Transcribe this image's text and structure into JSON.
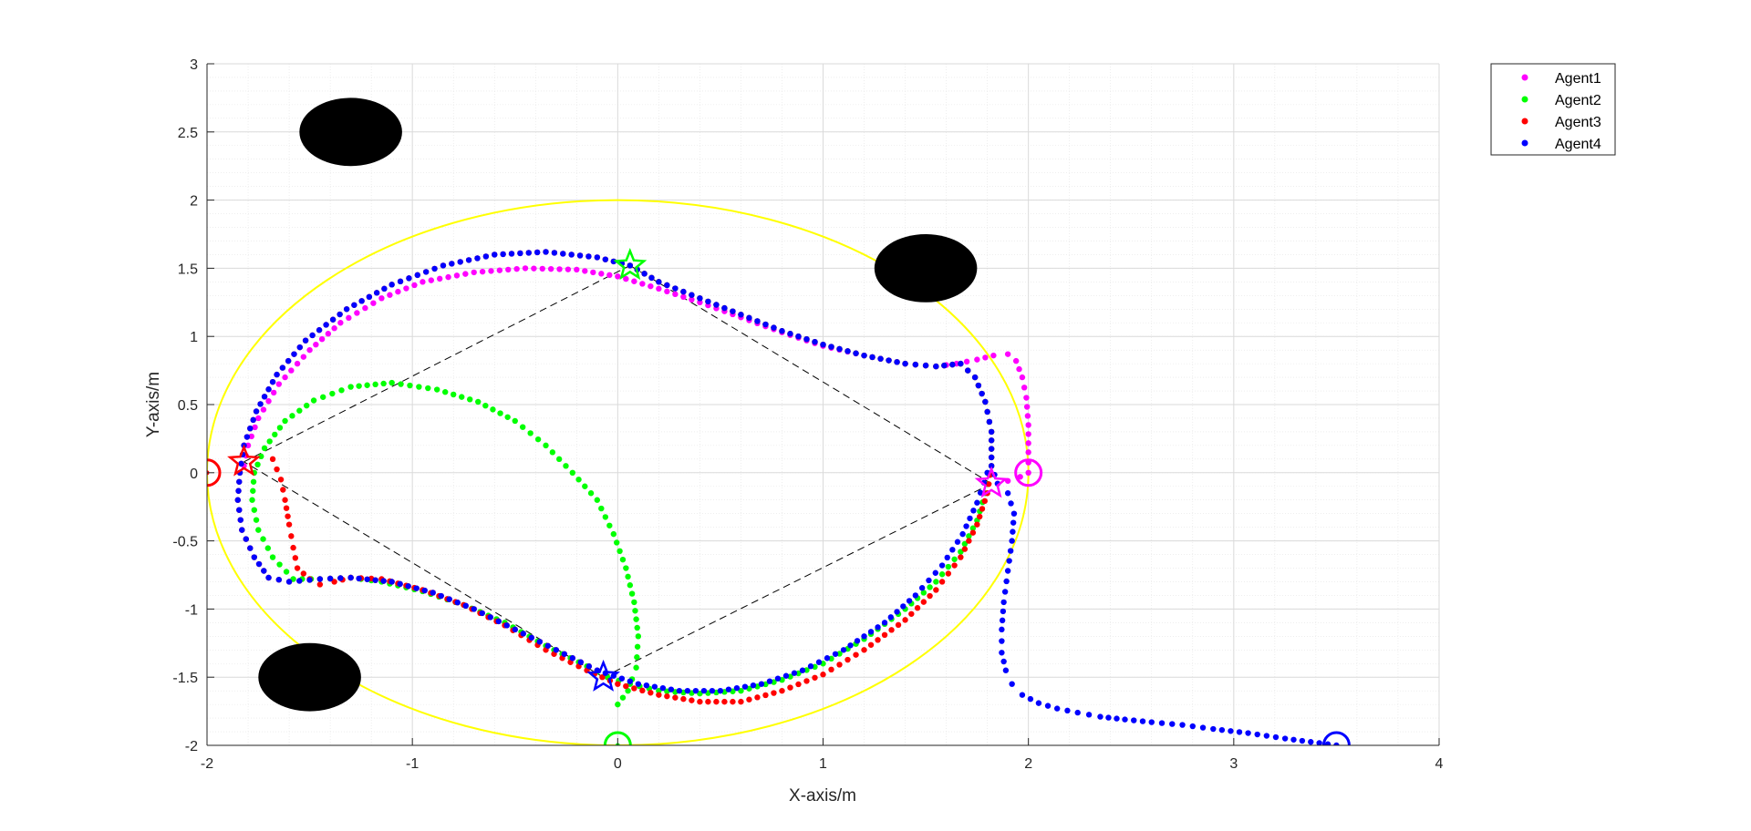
{
  "chart_data": {
    "type": "scatter",
    "xlabel": "X-axis/m",
    "ylabel": "Y-axis/m",
    "xlim": [
      -2,
      4
    ],
    "ylim": [
      -2,
      3
    ],
    "x_ticks": [
      "-2",
      "-1",
      "0",
      "1",
      "2",
      "3",
      "4"
    ],
    "y_ticks": [
      "-2",
      "-1.5",
      "-1",
      "-0.5",
      "0",
      "0.5",
      "1",
      "1.5",
      "2",
      "2.5",
      "3"
    ],
    "x_tick_values": [
      -2,
      -1,
      0,
      1,
      2,
      3,
      4
    ],
    "y_tick_values": [
      -2,
      -1.5,
      -1,
      -0.5,
      0,
      0.5,
      1,
      1.5,
      2,
      2.5,
      3
    ],
    "grid": true,
    "minor_grid": true,
    "legend_position": "outside top-right",
    "legend": [
      "Agent1",
      "Agent2",
      "Agent3",
      "Agent4"
    ],
    "series": [
      {
        "name": "Agent1",
        "color": "#ff00ff",
        "start": [
          2,
          0
        ],
        "goal": [
          1.82,
          -0.08
        ],
        "points": [
          [
            -1.82,
            0.05
          ],
          [
            -1.8,
            0.2
          ],
          [
            -1.75,
            0.4
          ],
          [
            -1.65,
            0.65
          ],
          [
            -1.5,
            0.9
          ],
          [
            -1.35,
            1.1
          ],
          [
            -1.15,
            1.28
          ],
          [
            -0.95,
            1.4
          ],
          [
            -0.7,
            1.47
          ],
          [
            -0.45,
            1.5
          ],
          [
            -0.2,
            1.49
          ],
          [
            0.0,
            1.44
          ],
          [
            0.2,
            1.35
          ],
          [
            0.4,
            1.25
          ],
          [
            0.6,
            1.14
          ],
          [
            0.8,
            1.03
          ],
          [
            1.0,
            0.93
          ],
          [
            1.2,
            0.86
          ],
          [
            1.4,
            0.8
          ],
          [
            1.55,
            0.78
          ],
          [
            1.65,
            0.8
          ],
          [
            1.75,
            0.83
          ],
          [
            1.83,
            0.86
          ],
          [
            1.9,
            0.87
          ],
          [
            1.94,
            0.82
          ],
          [
            1.97,
            0.7
          ],
          [
            1.99,
            0.55
          ],
          [
            2.0,
            0.35
          ],
          [
            2.0,
            0.15
          ],
          [
            2.0,
            0.0
          ],
          [
            1.96,
            -0.03
          ],
          [
            1.9,
            -0.06
          ],
          [
            1.85,
            -0.08
          ]
        ]
      },
      {
        "name": "Agent2",
        "color": "#00ff00",
        "start": [
          0,
          -2
        ],
        "goal": [
          0.06,
          1.52
        ],
        "points": [
          [
            0.0,
            -1.7
          ],
          [
            0.05,
            -1.6
          ],
          [
            0.09,
            -1.43
          ],
          [
            0.1,
            -1.2
          ],
          [
            0.08,
            -0.95
          ],
          [
            0.04,
            -0.7
          ],
          [
            -0.02,
            -0.45
          ],
          [
            -0.1,
            -0.2
          ],
          [
            -0.22,
            0.0
          ],
          [
            -0.35,
            0.2
          ],
          [
            -0.5,
            0.38
          ],
          [
            -0.68,
            0.52
          ],
          [
            -0.88,
            0.61
          ],
          [
            -1.1,
            0.66
          ],
          [
            -1.3,
            0.63
          ],
          [
            -1.48,
            0.53
          ],
          [
            -1.62,
            0.38
          ],
          [
            -1.72,
            0.18
          ],
          [
            -1.77,
            0.0
          ],
          [
            -1.78,
            -0.2
          ],
          [
            -1.75,
            -0.42
          ],
          [
            -1.68,
            -0.62
          ],
          [
            -1.58,
            -0.78
          ],
          [
            -1.45,
            -0.78
          ],
          [
            -1.3,
            -0.77
          ],
          [
            -1.15,
            -0.8
          ],
          [
            -0.95,
            -0.87
          ],
          [
            -0.75,
            -0.97
          ],
          [
            -0.55,
            -1.1
          ],
          [
            -0.35,
            -1.27
          ],
          [
            -0.15,
            -1.42
          ],
          [
            -0.05,
            -1.5
          ],
          [
            0.06,
            -1.55
          ],
          [
            0.2,
            -1.6
          ],
          [
            0.4,
            -1.62
          ],
          [
            0.6,
            -1.6
          ],
          [
            0.8,
            -1.52
          ],
          [
            1.0,
            -1.4
          ],
          [
            1.2,
            -1.22
          ],
          [
            1.4,
            -1.0
          ],
          [
            1.55,
            -0.8
          ],
          [
            1.67,
            -0.58
          ],
          [
            1.75,
            -0.35
          ],
          [
            1.79,
            -0.15
          ],
          [
            1.82,
            0.05
          ],
          [
            1.82,
            0.3
          ],
          [
            1.79,
            0.52
          ],
          [
            1.74,
            0.7
          ],
          [
            1.67,
            0.8
          ],
          [
            1.55,
            0.78
          ],
          [
            1.4,
            0.8
          ],
          [
            1.2,
            0.86
          ],
          [
            1.0,
            0.94
          ],
          [
            0.8,
            1.04
          ],
          [
            0.6,
            1.16
          ],
          [
            0.4,
            1.28
          ],
          [
            0.2,
            1.4
          ],
          [
            0.06,
            1.52
          ]
        ]
      },
      {
        "name": "Agent3",
        "color": "#ff0000",
        "start": [
          -2,
          0
        ],
        "goal": [
          -1.82,
          0.08
        ],
        "points": [
          [
            -1.68,
            0.1
          ],
          [
            -1.64,
            -0.05
          ],
          [
            -1.62,
            -0.2
          ],
          [
            -1.6,
            -0.38
          ],
          [
            -1.58,
            -0.55
          ],
          [
            -1.56,
            -0.7
          ],
          [
            -1.5,
            -0.78
          ],
          [
            -1.45,
            -0.82
          ],
          [
            -1.38,
            -0.8
          ],
          [
            -1.3,
            -0.77
          ],
          [
            -1.15,
            -0.78
          ],
          [
            -0.95,
            -0.86
          ],
          [
            -0.75,
            -0.97
          ],
          [
            -0.55,
            -1.12
          ],
          [
            -0.35,
            -1.3
          ],
          [
            -0.15,
            -1.45
          ],
          [
            0.0,
            -1.55
          ],
          [
            0.2,
            -1.63
          ],
          [
            0.4,
            -1.68
          ],
          [
            0.6,
            -1.68
          ],
          [
            0.8,
            -1.6
          ],
          [
            1.0,
            -1.48
          ],
          [
            1.2,
            -1.3
          ],
          [
            1.4,
            -1.08
          ],
          [
            1.55,
            -0.86
          ],
          [
            1.67,
            -0.62
          ],
          [
            1.75,
            -0.38
          ],
          [
            1.8,
            -0.15
          ],
          [
            1.82,
            0.05
          ],
          [
            1.82,
            0.3
          ],
          [
            1.79,
            0.52
          ],
          [
            1.74,
            0.7
          ],
          [
            1.67,
            0.8
          ],
          [
            1.55,
            0.78
          ],
          [
            1.4,
            0.8
          ],
          [
            1.2,
            0.86
          ],
          [
            1.0,
            0.94
          ],
          [
            0.8,
            1.04
          ],
          [
            0.6,
            1.16
          ],
          [
            0.4,
            1.28
          ],
          [
            0.2,
            1.4
          ],
          [
            0.06,
            1.52
          ],
          [
            -0.1,
            1.58
          ],
          [
            -0.35,
            1.62
          ],
          [
            -0.6,
            1.6
          ],
          [
            -0.85,
            1.52
          ],
          [
            -1.1,
            1.38
          ],
          [
            -1.32,
            1.2
          ],
          [
            -1.52,
            0.97
          ],
          [
            -1.66,
            0.72
          ],
          [
            -1.76,
            0.45
          ],
          [
            -1.82,
            0.2
          ],
          [
            -1.84,
            0.0
          ],
          [
            -1.85,
            -0.2
          ],
          [
            -1.83,
            -0.42
          ],
          [
            -1.77,
            -0.62
          ],
          [
            -1.7,
            -0.77
          ],
          [
            -1.6,
            -0.8
          ],
          [
            -1.45,
            -0.78
          ],
          [
            -1.3,
            -0.77
          ],
          [
            -1.1,
            -0.8
          ],
          [
            -0.9,
            -0.88
          ],
          [
            -0.7,
            -1.0
          ],
          [
            -0.5,
            -1.15
          ],
          [
            -0.3,
            -1.3
          ],
          [
            -0.1,
            -1.45
          ]
        ]
      },
      {
        "name": "Agent4",
        "color": "#0000ff",
        "start": [
          3.5,
          -2
        ],
        "goal": [
          -0.07,
          -1.5
        ],
        "points": [
          [
            3.5,
            -2.0
          ],
          [
            3.25,
            -1.95
          ],
          [
            3.07,
            -1.91
          ],
          [
            2.9,
            -1.88
          ],
          [
            2.75,
            -1.85
          ],
          [
            2.6,
            -1.83
          ],
          [
            2.47,
            -1.81
          ],
          [
            2.35,
            -1.79
          ],
          [
            2.24,
            -1.76
          ],
          [
            2.14,
            -1.73
          ],
          [
            2.05,
            -1.69
          ],
          [
            1.97,
            -1.63
          ],
          [
            1.92,
            -1.55
          ],
          [
            1.89,
            -1.45
          ],
          [
            1.87,
            -1.32
          ],
          [
            1.87,
            -1.15
          ],
          [
            1.88,
            -0.95
          ],
          [
            1.9,
            -0.72
          ],
          [
            1.92,
            -0.5
          ],
          [
            1.93,
            -0.3
          ],
          [
            1.9,
            -0.15
          ],
          [
            1.85,
            -0.08
          ],
          [
            1.82,
            0.05
          ],
          [
            1.82,
            0.3
          ],
          [
            1.79,
            0.52
          ],
          [
            1.74,
            0.7
          ],
          [
            1.67,
            0.8
          ],
          [
            1.55,
            0.78
          ],
          [
            1.4,
            0.8
          ],
          [
            1.2,
            0.86
          ],
          [
            1.0,
            0.94
          ],
          [
            0.8,
            1.04
          ],
          [
            0.6,
            1.16
          ],
          [
            0.4,
            1.28
          ],
          [
            0.2,
            1.4
          ],
          [
            0.06,
            1.52
          ],
          [
            -0.1,
            1.58
          ],
          [
            -0.35,
            1.62
          ],
          [
            -0.6,
            1.6
          ],
          [
            -0.85,
            1.52
          ],
          [
            -1.1,
            1.38
          ],
          [
            -1.32,
            1.2
          ],
          [
            -1.52,
            0.97
          ],
          [
            -1.66,
            0.72
          ],
          [
            -1.76,
            0.45
          ],
          [
            -1.82,
            0.2
          ],
          [
            -1.84,
            0.0
          ],
          [
            -1.85,
            -0.2
          ],
          [
            -1.83,
            -0.42
          ],
          [
            -1.77,
            -0.62
          ],
          [
            -1.7,
            -0.77
          ],
          [
            -1.6,
            -0.8
          ],
          [
            -1.45,
            -0.78
          ],
          [
            -1.3,
            -0.77
          ],
          [
            -1.1,
            -0.8
          ],
          [
            -0.9,
            -0.88
          ],
          [
            -0.7,
            -1.0
          ],
          [
            -0.5,
            -1.15
          ],
          [
            -0.3,
            -1.3
          ],
          [
            -0.1,
            -1.45
          ],
          [
            0.1,
            -1.55
          ],
          [
            0.3,
            -1.6
          ],
          [
            0.5,
            -1.6
          ],
          [
            0.7,
            -1.55
          ],
          [
            0.9,
            -1.45
          ],
          [
            1.1,
            -1.3
          ],
          [
            1.3,
            -1.1
          ],
          [
            1.45,
            -0.9
          ],
          [
            1.58,
            -0.68
          ],
          [
            1.68,
            -0.45
          ],
          [
            1.75,
            -0.22
          ],
          [
            1.8,
            0.0
          ]
        ]
      }
    ],
    "formation_lines": [
      [
        [
          0.06,
          1.52
        ],
        [
          1.82,
          -0.08
        ]
      ],
      [
        [
          1.82,
          -0.08
        ],
        [
          -0.07,
          -1.5
        ]
      ],
      [
        [
          -0.07,
          -1.5
        ],
        [
          -1.82,
          0.08
        ]
      ],
      [
        [
          -1.82,
          0.08
        ],
        [
          0.06,
          1.52
        ]
      ]
    ],
    "reference_circle": {
      "center": [
        0,
        0
      ],
      "radius": 2,
      "color": "#ffff00"
    },
    "obstacles": [
      {
        "center": [
          -1.3,
          2.5
        ],
        "rx": 0.25,
        "ry": 0.25
      },
      {
        "center": [
          1.5,
          1.5
        ],
        "rx": 0.25,
        "ry": 0.25
      },
      {
        "center": [
          -1.5,
          -1.5
        ],
        "rx": 0.25,
        "ry": 0.25
      }
    ]
  }
}
